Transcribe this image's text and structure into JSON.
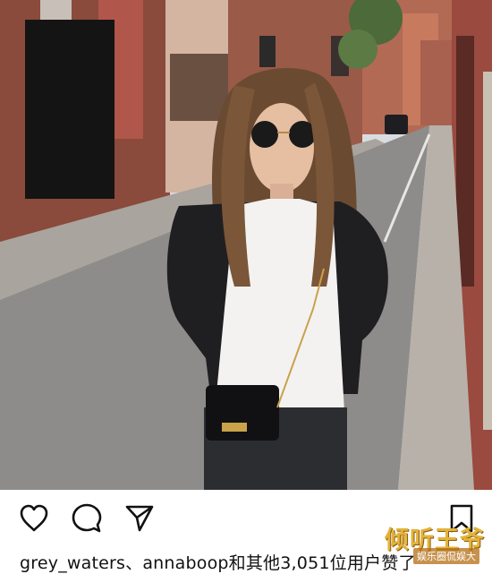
{
  "post": {
    "image_alt": "",
    "likes_text": "grey_waters、annaboop和其他3,051位用户赞了",
    "watermark_main": "倾听王爷",
    "watermark_sub": "娱乐圈侃娱大"
  },
  "actions": [
    {
      "name": "like-button",
      "icon": "heart-icon"
    },
    {
      "name": "comment-button",
      "icon": "comment-icon"
    },
    {
      "name": "share-button",
      "icon": "paper-plane-icon"
    },
    {
      "name": "save-button",
      "icon": "bookmark-icon"
    }
  ],
  "colors": {
    "icon": "#111111",
    "text": "#111111",
    "watermark": "#e3b33a"
  }
}
